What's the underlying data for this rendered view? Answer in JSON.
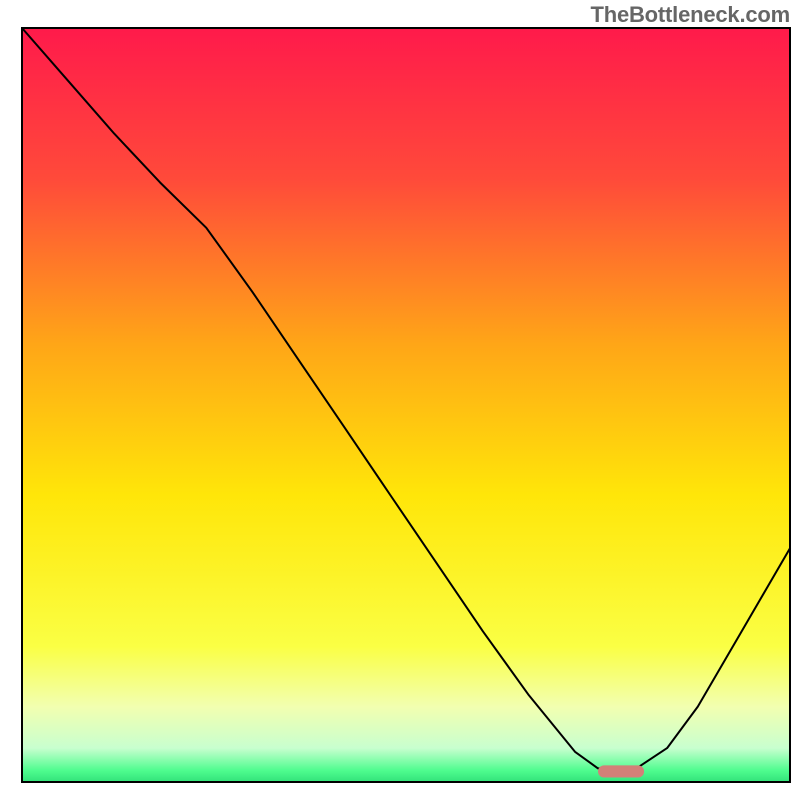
{
  "watermark": "TheBottleneck.com",
  "chart_data": {
    "type": "line",
    "title": "",
    "xlabel": "",
    "ylabel": "",
    "xlim": [
      0,
      100
    ],
    "ylim": [
      0,
      100
    ],
    "gradient_background": true,
    "gradient_stops": [
      {
        "offset": 0.0,
        "color": "#ff1a4b"
      },
      {
        "offset": 0.2,
        "color": "#ff4a3a"
      },
      {
        "offset": 0.42,
        "color": "#ffa617"
      },
      {
        "offset": 0.62,
        "color": "#ffe609"
      },
      {
        "offset": 0.82,
        "color": "#faff44"
      },
      {
        "offset": 0.9,
        "color": "#f2ffb0"
      },
      {
        "offset": 0.955,
        "color": "#c8ffcf"
      },
      {
        "offset": 0.985,
        "color": "#4efc8e"
      },
      {
        "offset": 1.0,
        "color": "#32e27a"
      }
    ],
    "series": [
      {
        "name": "bottleneck-curve",
        "color": "#000000",
        "stroke_width": 2,
        "x": [
          0.0,
          6.0,
          12.0,
          18.0,
          24.0,
          30.0,
          36.0,
          42.0,
          48.0,
          54.0,
          60.0,
          66.0,
          72.0,
          75.0,
          80.0,
          84.0,
          88.0,
          92.0,
          96.0,
          100.0
        ],
        "y": [
          100.0,
          93.0,
          86.0,
          79.5,
          73.5,
          65.0,
          56.0,
          47.0,
          38.0,
          29.0,
          20.0,
          11.5,
          4.0,
          1.8,
          1.8,
          4.5,
          10.0,
          17.0,
          24.0,
          31.0
        ]
      }
    ],
    "marker": {
      "name": "optimal-marker",
      "x_start": 75.0,
      "x_end": 81.0,
      "y": 1.4,
      "color": "#d38078",
      "thickness": 1.6
    }
  }
}
